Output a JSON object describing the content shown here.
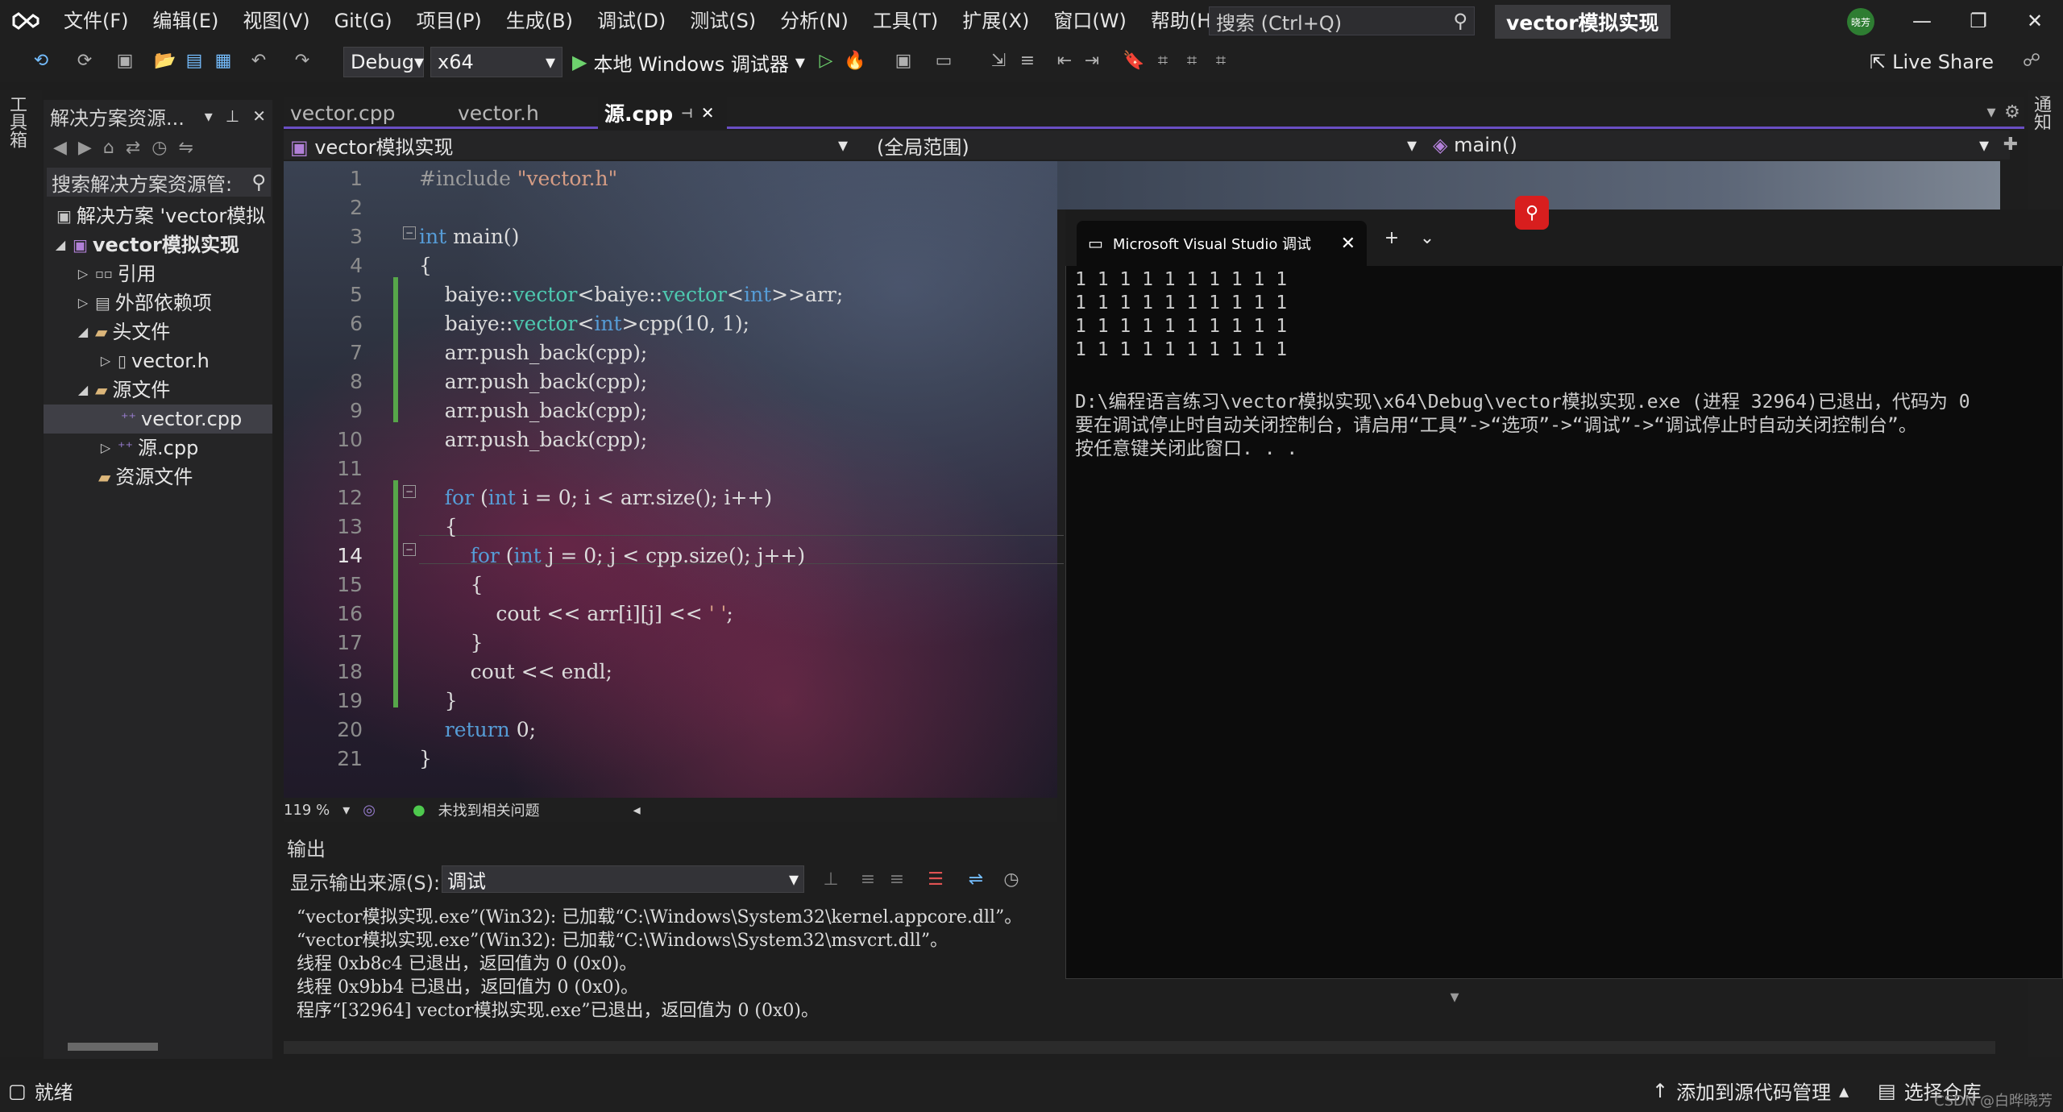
{
  "menu": [
    "文件(F)",
    "编辑(E)",
    "视图(V)",
    "Git(G)",
    "项目(P)",
    "生成(B)",
    "调试(D)",
    "测试(S)",
    "分析(N)",
    "工具(T)",
    "扩展(X)",
    "窗口(W)",
    "帮助(H)"
  ],
  "search": {
    "placeholder": "搜索 (Ctrl+Q)"
  },
  "solution_title": "vector模拟实现",
  "user_initials": "晓芳",
  "toolbar": {
    "config": "Debug",
    "platform": "x64",
    "run_label": "本地 Windows 调试器",
    "live_share": "Live Share"
  },
  "side_tabs": {
    "toolbox": "工具箱",
    "notifications": "通知"
  },
  "solution_explorer": {
    "title": "解决方案资源...",
    "search_placeholder": "搜索解决方案资源管:",
    "tree": [
      {
        "label": "解决方案 'vector模拟",
        "level": 0
      },
      {
        "label": "vector模拟实现",
        "level": 1
      },
      {
        "label": "引用",
        "level": 2
      },
      {
        "label": "外部依赖项",
        "level": 2
      },
      {
        "label": "头文件",
        "level": 2
      },
      {
        "label": "vector.h",
        "level": 3
      },
      {
        "label": "源文件",
        "level": 2
      },
      {
        "label": "vector.cpp",
        "level": 3
      },
      {
        "label": "源.cpp",
        "level": 3
      },
      {
        "label": "资源文件",
        "level": 2
      }
    ]
  },
  "editor": {
    "tabs": [
      "vector.cpp",
      "vector.h",
      "源.cpp"
    ],
    "active_tab": "源.cpp",
    "nav_project": "vector模拟实现",
    "nav_scope": "(全局范围)",
    "nav_member": "main()",
    "line_numbers": [
      "1",
      "2",
      "3",
      "4",
      "5",
      "6",
      "7",
      "8",
      "9",
      "10",
      "11",
      "12",
      "13",
      "14",
      "15",
      "16",
      "17",
      "18",
      "19",
      "20",
      "21"
    ],
    "current_line": "14",
    "zoom": "119 %",
    "issues": "未找到相关问题"
  },
  "code": [
    "#include \"vector.h\"",
    "",
    "int main()",
    "{",
    "    baiye::vector<baiye::vector<int>>arr;",
    "    baiye::vector<int>cpp(10, 1);",
    "    arr.push_back(cpp);",
    "    arr.push_back(cpp);",
    "    arr.push_back(cpp);",
    "    arr.push_back(cpp);",
    "",
    "    for (int i = 0; i < arr.size(); i++)",
    "    {",
    "        for (int j = 0; j < cpp.size(); j++)",
    "        {",
    "            cout << arr[i][j] << ' ';",
    "        }",
    "        cout << endl;",
    "    }",
    "    return 0;",
    "}"
  ],
  "output": {
    "title": "输出",
    "source_label": "显示输出来源(S):",
    "source_value": "调试",
    "lines": [
      "“vector模拟实现.exe”(Win32): 已加载“C:\\Windows\\System32\\kernel.appcore.dll”。",
      "“vector模拟实现.exe”(Win32): 已加载“C:\\Windows\\System32\\msvcrt.dll”。",
      "线程 0xb8c4 已退出，返回值为 0 (0x0)。",
      "线程 0x9bb4 已退出，返回值为 0 (0x0)。",
      "程序“[32964] vector模拟实现.exe”已退出，返回值为 0 (0x0)。"
    ]
  },
  "console": {
    "tab_title": "Microsoft Visual Studio 调试",
    "lines": [
      "1 1 1 1 1 1 1 1 1 1",
      "1 1 1 1 1 1 1 1 1 1",
      "1 1 1 1 1 1 1 1 1 1",
      "1 1 1 1 1 1 1 1 1 1",
      "",
      "D:\\编程语言练习\\vector模拟实现\\x64\\Debug\\vector模拟实现.exe (进程 32964)已退出，代码为 0",
      "要在调试停止时自动关闭控制台，请启用“工具”->“选项”->“调试”->“调试停止时自动关闭控制台”。",
      "按任意键关闭此窗口. . ."
    ]
  },
  "status": {
    "ready": "就绪",
    "source_control": "添加到源代码管理",
    "repo": "选择仓库",
    "watermark": "CSDN @白晔晓芳"
  }
}
